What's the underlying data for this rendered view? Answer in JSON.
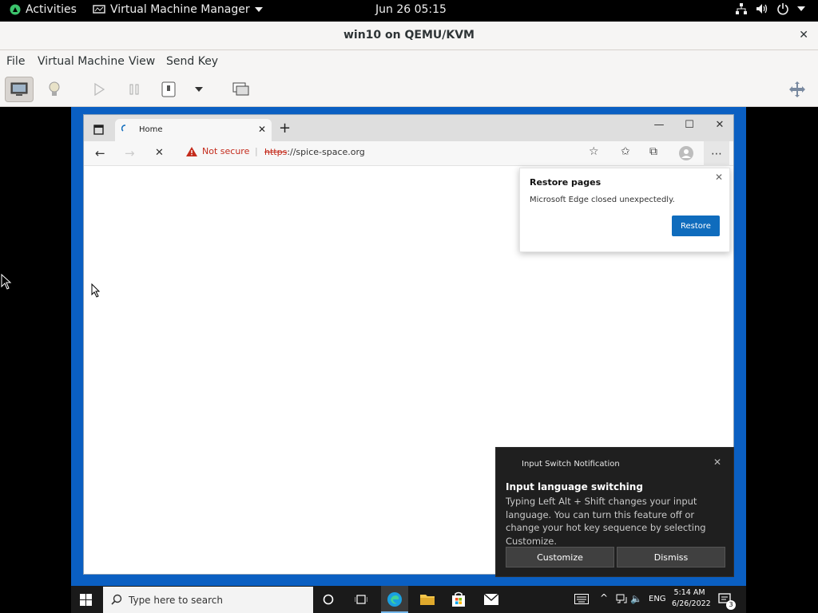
{
  "gnome": {
    "activities": "Activities",
    "app_name": "Virtual Machine Manager",
    "clock": "Jun 26  05:15"
  },
  "vm_window": {
    "title": "win10 on QEMU/KVM",
    "menu": [
      "File",
      "Virtual Machine",
      "View",
      "Send Key"
    ]
  },
  "edge": {
    "tab_title": "Home",
    "security_label": "Not secure",
    "url_scheme": "https",
    "url_rest": "://spice-space.org",
    "restore_popup": {
      "title": "Restore pages",
      "message": "Microsoft Edge closed unexpectedly.",
      "button": "Restore"
    }
  },
  "notification": {
    "header": "Input Switch Notification",
    "title": "Input language switching",
    "body": "Typing Left Alt + Shift changes your input language. You can turn this feature off or change your hot key sequence by selecting Customize.",
    "customize_label": "Customize",
    "dismiss_label": "Dismiss"
  },
  "taskbar": {
    "search_placeholder": "Type here to search",
    "language": "ENG",
    "time": "5:14 AM",
    "date": "6/26/2022",
    "notif_count": "3"
  },
  "colors": {
    "desktop_blue": "#0a5fc2",
    "edge_accent": "#0f6cbd",
    "insecure_red": "#c42b1c"
  }
}
